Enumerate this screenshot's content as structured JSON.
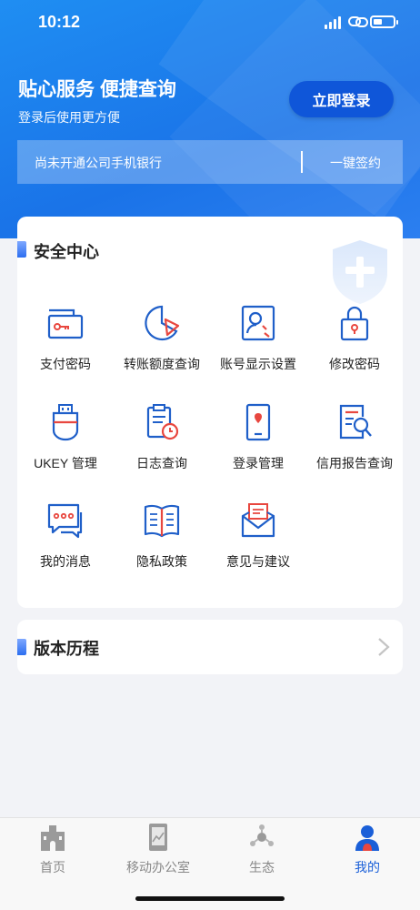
{
  "status_bar": {
    "time": "10:12"
  },
  "hero": {
    "title": "贴心服务 便捷查询",
    "subtitle": "登录后使用更方便",
    "login_button": "立即登录",
    "sign_bar": {
      "text": "尚未开通公司手机银行",
      "action": "一键签约"
    }
  },
  "security": {
    "title": "安全中心",
    "items": [
      {
        "label": "支付密码",
        "icon": "payment-password-icon"
      },
      {
        "label": "转账额度查询",
        "icon": "transfer-limit-icon"
      },
      {
        "label": "账号显示设置",
        "icon": "account-display-icon"
      },
      {
        "label": "修改密码",
        "icon": "change-password-icon"
      },
      {
        "label": "UKEY 管理",
        "icon": "ukey-icon"
      },
      {
        "label": "日志查询",
        "icon": "log-query-icon"
      },
      {
        "label": "登录管理",
        "icon": "login-management-icon"
      },
      {
        "label": "信用报告查询",
        "icon": "credit-report-icon"
      },
      {
        "label": "我的消息",
        "icon": "message-icon"
      },
      {
        "label": "隐私政策",
        "icon": "privacy-policy-icon"
      },
      {
        "label": "意见与建议",
        "icon": "feedback-icon"
      }
    ]
  },
  "history": {
    "title": "版本历程"
  },
  "tabbar": {
    "tabs": [
      {
        "label": "首页",
        "icon": "home-icon",
        "active": false
      },
      {
        "label": "移动办公室",
        "icon": "mobile-office-icon",
        "active": false
      },
      {
        "label": "生态",
        "icon": "ecosystem-icon",
        "active": false
      },
      {
        "label": "我的",
        "icon": "profile-icon",
        "active": true
      }
    ]
  },
  "colors": {
    "primary": "#1a73e8",
    "accent_red": "#e8473f",
    "icon_blue": "#1f5fc9"
  }
}
